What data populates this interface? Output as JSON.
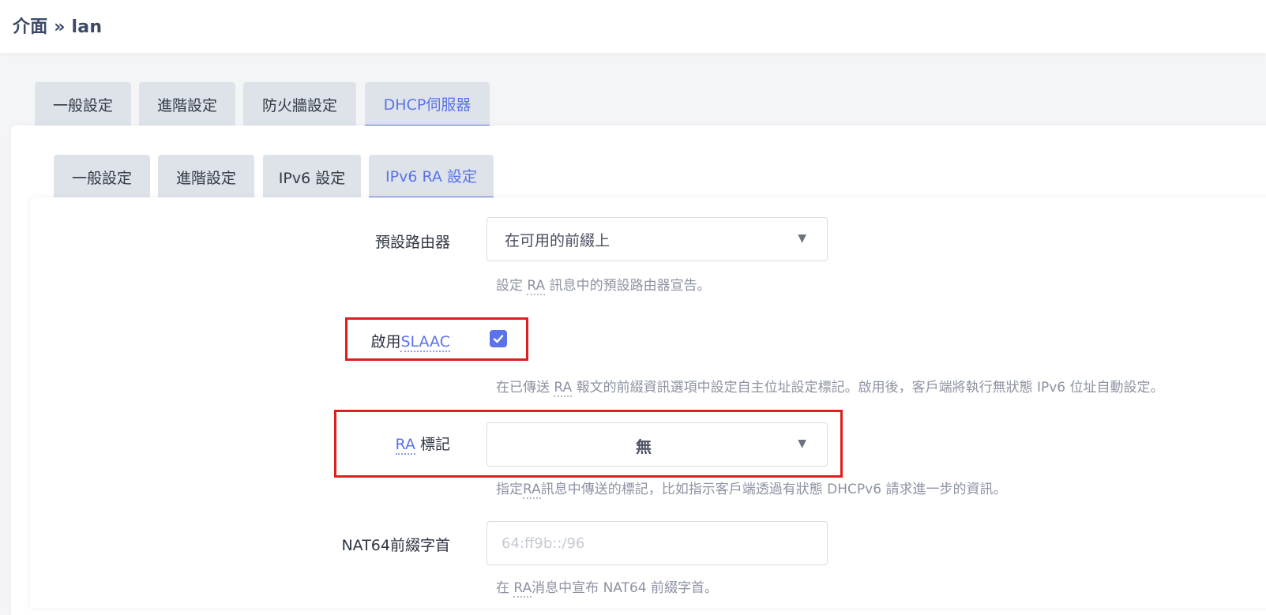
{
  "header": {
    "title": "介面 » lan"
  },
  "tabs_top": [
    {
      "label": "一般設定",
      "active": false
    },
    {
      "label": "進階設定",
      "active": false
    },
    {
      "label": "防火牆設定",
      "active": false
    },
    {
      "label": "DHCP伺服器",
      "active": true
    }
  ],
  "tabs_sub": [
    {
      "label": "一般設定",
      "active": false
    },
    {
      "label": "進階設定",
      "active": false
    },
    {
      "label": "IPv6 設定",
      "active": false
    },
    {
      "label": "IPv6 RA 設定",
      "active": true
    }
  ],
  "form": {
    "default_router": {
      "label": "預設路由器",
      "value": "在可用的前綴上",
      "help_prefix": "設定 ",
      "help_abbr": "RA",
      "help_suffix": " 訊息中的預設路由器宣告。"
    },
    "slaac": {
      "label_prefix": "啟用",
      "label_abbr": "SLAAC",
      "checked": true,
      "help_prefix": "在已傳送 ",
      "help_abbr": "RA",
      "help_suffix": " 報文的前綴資訊選項中設定自主位址設定標記。啟用後，客戶端將執行無狀態 IPv6 位址自動設定。"
    },
    "ra_flags": {
      "label_abbr": "RA",
      "label_suffix": " 標記",
      "value": "無",
      "help_prefix": "指定",
      "help_abbr": "RA",
      "help_suffix": "訊息中傳送的標記，比如指示客戶端透過有狀態 DHCPv6 請求進一步的資訊。"
    },
    "nat64": {
      "label": "NAT64前綴字首",
      "placeholder": "64:ff9b::/96",
      "value": "",
      "help_prefix": "在 ",
      "help_abbr": "RA",
      "help_suffix": "消息中宣布 NAT64 前綴字首。"
    }
  },
  "colors": {
    "accent": "#5b73e8",
    "highlight": "#e01e1e",
    "tab_bg": "#dee3ea"
  }
}
